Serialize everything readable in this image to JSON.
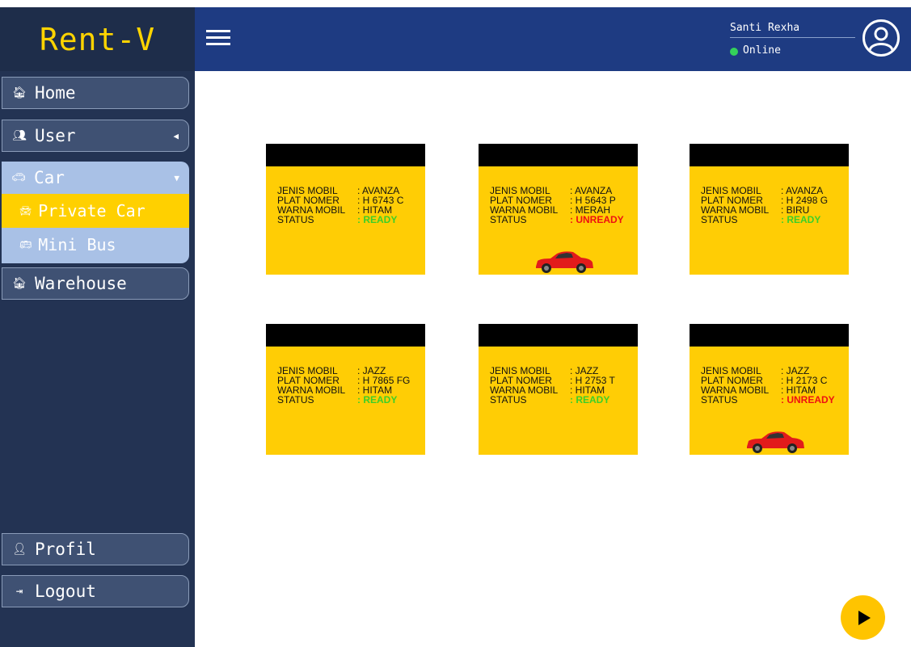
{
  "app": {
    "logo": "Rent-V"
  },
  "header": {
    "user_name": "Santi Rexha",
    "status": "Online"
  },
  "sidebar": {
    "home": "Home",
    "user": "User",
    "car": "Car",
    "private_car": "Private Car",
    "mini_bus": "Mini Bus",
    "warehouse": "Warehouse",
    "profil": "Profil",
    "logout": "Logout"
  },
  "labels": {
    "jenis": "JENIS MOBIL   ",
    "plat": "PLAT NOMER    ",
    "warna": "WARNA MOBIL ",
    "status": "STATUS          "
  },
  "cars": [
    {
      "jenis": ": AVANZA",
      "plat": ": H 6743 C",
      "warna": ": HITAM",
      "status": ": READY"
    },
    {
      "jenis": ": AVANZA",
      "plat": ": H 5643 P",
      "warna": ": MERAH",
      "status": ": UNREADY"
    },
    {
      "jenis": ": AVANZA",
      "plat": ": H 2498 G",
      "warna": ": BIRU",
      "status": ": READY"
    },
    {
      "jenis": ": JAZZ",
      "plat": ": H 7865 FG",
      "warna": ": HITAM",
      "status": ": READY"
    },
    {
      "jenis": ": JAZZ",
      "plat": ": H 2753 T",
      "warna": ": HITAM",
      "status": ": READY"
    },
    {
      "jenis": ": JAZZ",
      "plat": ": H 2173 C",
      "warna": ": HITAM",
      "status": ": UNREADY"
    }
  ],
  "colors": {
    "sidebar": "#233353",
    "header": "#1e3b82",
    "accent": "#ffd000",
    "card": "#ffcd05",
    "ready": "#3ccf29",
    "unready": "#ee1111"
  }
}
